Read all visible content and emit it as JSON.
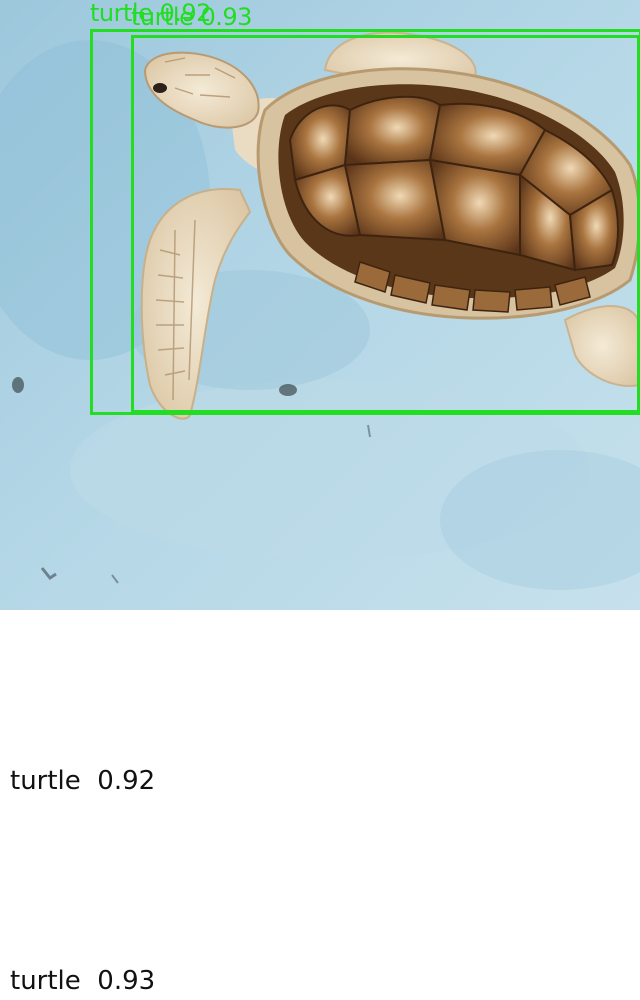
{
  "detections": [
    {
      "label": "turtle",
      "score": "0.92",
      "text": "turtle 0.92"
    },
    {
      "label": "turtle",
      "score": "0.93",
      "text": "turtle 0.93"
    }
  ],
  "captions": [
    "turtle  0.92",
    "turtle  0.93"
  ],
  "colors": {
    "box": "#22dd22",
    "water": "#a9cfe0",
    "shell": "#7a4f2a",
    "skin": "#e9dcc4"
  }
}
